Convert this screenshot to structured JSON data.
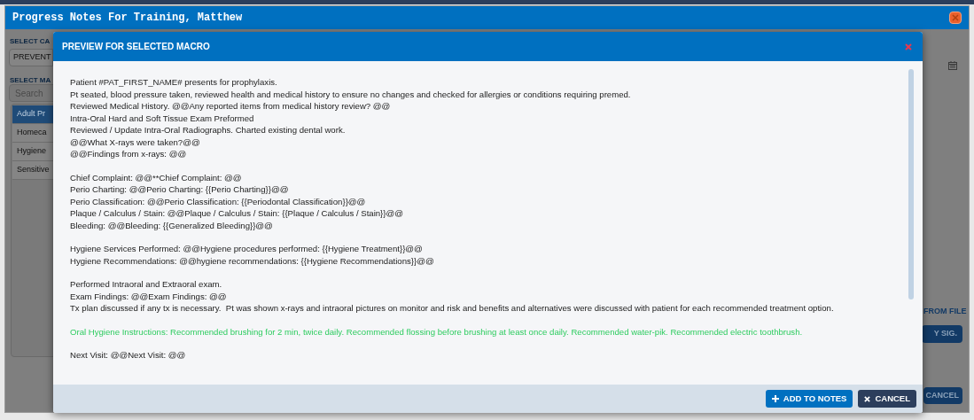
{
  "window": {
    "title": "Progress Notes For Training, Matthew"
  },
  "background": {
    "category_label": "SELECT CA",
    "category_value": "PREVENT",
    "macro_label": "SELECT MA",
    "search": {
      "placeholder": "Search"
    },
    "macros": [
      {
        "label": "Adult Pr",
        "selected": true
      },
      {
        "label": "Homeca",
        "selected": false
      },
      {
        "label": "Hygiene",
        "selected": false
      },
      {
        "label": "Sensitive",
        "selected": false
      }
    ],
    "from_file": "FROM FILE",
    "sig_button": "Y SIG.",
    "cancel_button": "CANCEL"
  },
  "preview": {
    "title": "PREVIEW FOR SELECTED MACRO",
    "paragraphs": [
      {
        "kind": "normal",
        "lines": [
          "Patient #PAT_FIRST_NAME# presents for prophylaxis.",
          "Pt seated, blood pressure taken, reviewed health and medical history to ensure no changes and checked for allergies or conditions requiring premed.",
          "Reviewed Medical History. @@Any reported items from medical history review? @@",
          "Intra-Oral Hard and Soft Tissue Exam Preformed",
          "Reviewed / Update Intra-Oral Radiographs. Charted existing dental work.",
          "@@What X-rays were taken?@@",
          "@@Findings from x-rays: @@"
        ]
      },
      {
        "kind": "normal",
        "lines": [
          "Chief Complaint: @@**Chief Complaint: @@",
          "Perio Charting: @@Perio Charting: {{Perio Charting}}@@",
          "Perio Classification: @@Perio Classification: {{Periodontal Classification}}@@",
          "Plaque / Calculus / Stain: @@Plaque / Calculus / Stain: {{Plaque / Calculus / Stain}}@@",
          "Bleeding: @@Bleeding: {{Generalized Bleeding}}@@"
        ]
      },
      {
        "kind": "normal",
        "lines": [
          "Hygiene Services Performed: @@Hygiene procedures performed: {{Hygiene Treatment}}@@",
          "Hygiene Recommendations: @@hygiene recommendations: {{Hygiene Recommendations}}@@"
        ]
      },
      {
        "kind": "normal",
        "lines": [
          "Performed Intraoral and Extraoral exam.",
          "Exam Findings: @@Exam Findings: @@",
          "Tx plan discussed if any tx is necessary.  Pt was shown x-rays and intraoral pictures on monitor and risk and benefits and alternatives were discussed with patient for each recommended treatment option."
        ]
      },
      {
        "kind": "highlight",
        "lines": [
          "Oral Hygiene Instructions: Recommended brushing for 2 min, twice daily. Recommended flossing before brushing at least once daily. Recommended water-pik. Recommended electric toothbrush."
        ]
      },
      {
        "kind": "normal",
        "lines": [
          "Next Visit: @@Next Visit: @@"
        ]
      }
    ],
    "add_button": "ADD TO NOTES",
    "cancel_button": "CANCEL"
  }
}
